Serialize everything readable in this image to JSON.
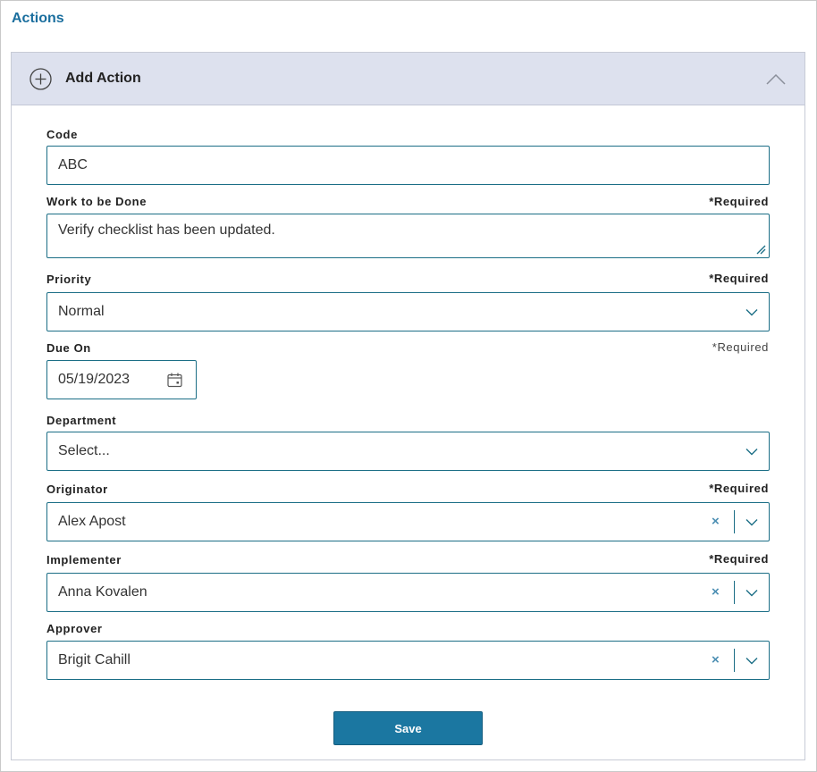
{
  "section": {
    "title": "Actions"
  },
  "panel": {
    "title": "Add Action"
  },
  "form": {
    "code": {
      "label": "Code",
      "value": "ABC"
    },
    "work": {
      "label": "Work to be Done",
      "required": "*Required",
      "value": "Verify checklist has been updated."
    },
    "priority": {
      "label": "Priority",
      "required": "*Required",
      "value": "Normal"
    },
    "due_on": {
      "label": "Due On",
      "required": "*Required",
      "value": "05/19/2023"
    },
    "department": {
      "label": "Department",
      "value": "Select..."
    },
    "originator": {
      "label": "Originator",
      "required": "*Required",
      "value": "Alex Apost"
    },
    "implementer": {
      "label": "Implementer",
      "required": "*Required",
      "value": "Anna Kovalen"
    },
    "approver": {
      "label": "Approver",
      "value": "Brigit Cahill"
    },
    "clear_glyph": "×"
  },
  "save_label": "Save",
  "icons": {
    "add": "plus-circle-icon",
    "collapse": "chevron-up-icon",
    "dropdown": "chevron-down-icon",
    "calendar": "calendar-icon",
    "resize": "resize-grip-icon",
    "clear": "clear-icon"
  },
  "colors": {
    "accent": "#1b77a1",
    "border": "#1b6e86",
    "header_bg": "#dde1ee",
    "title": "#1a6e9e"
  }
}
